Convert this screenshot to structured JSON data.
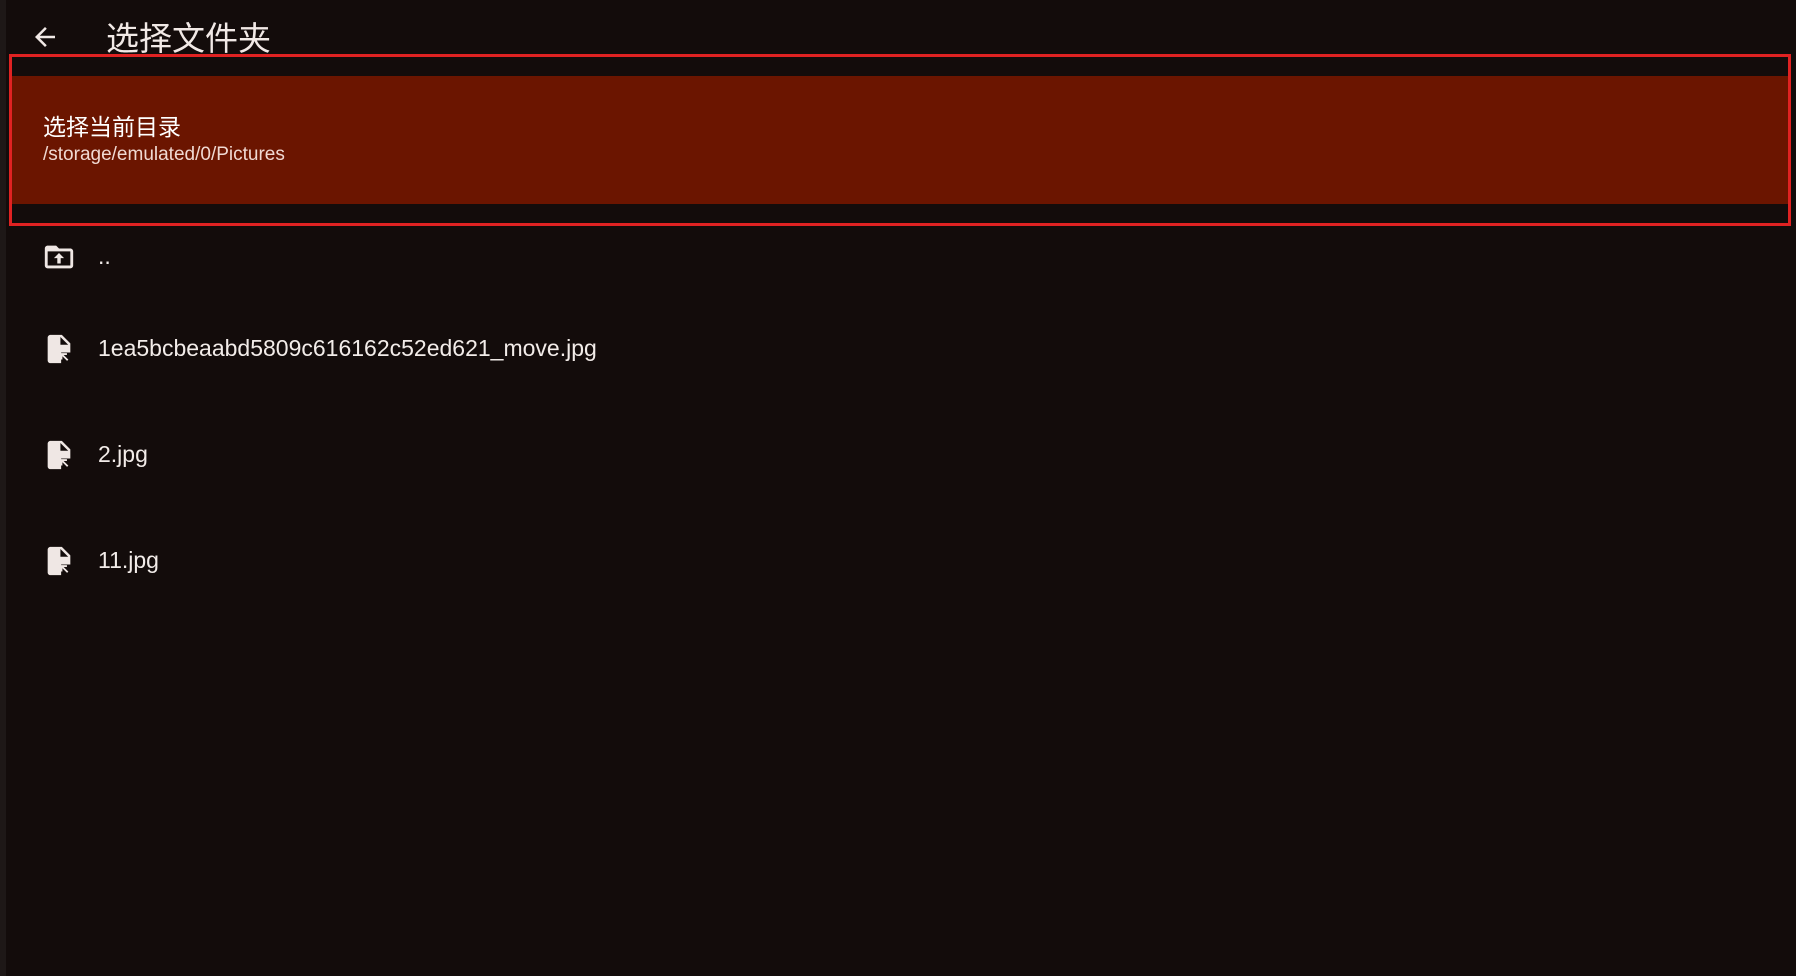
{
  "header": {
    "back_icon": "arrow-back-icon",
    "title": "选择文件夹"
  },
  "current_directory": {
    "label": "选择当前目录",
    "path": "/storage/emulated/0/Pictures"
  },
  "entries": [
    {
      "name": "..",
      "icon": "folder-up-icon"
    },
    {
      "name": "1ea5bcbeaabd5809c616162c52ed621_move.jpg",
      "icon": "file-move-icon"
    },
    {
      "name": "2.jpg",
      "icon": "file-move-icon"
    },
    {
      "name": "11.jpg",
      "icon": "file-move-icon"
    }
  ],
  "colors": {
    "background": "#130c0b",
    "selected_row": "#6b1500",
    "highlight_border": "#e02222",
    "text": "#efe7e4"
  }
}
